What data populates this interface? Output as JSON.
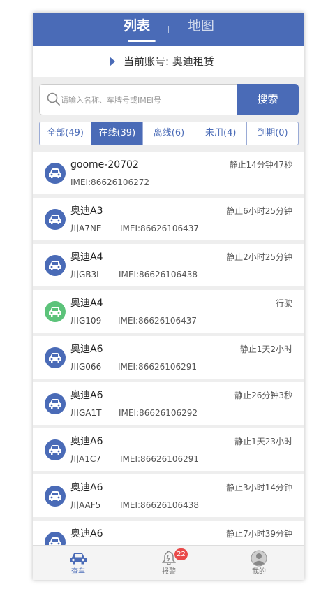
{
  "header": {
    "tabs": [
      {
        "label": "列表",
        "active": true
      },
      {
        "label": "地图",
        "active": false
      }
    ]
  },
  "account": {
    "text": "当前账号: 奥迪租赁"
  },
  "search": {
    "placeholder": "请输入名称、车牌号或IMEI号",
    "button_label": "搜索"
  },
  "filters": [
    {
      "label": "全部(49)",
      "active": false
    },
    {
      "label": "在线(39)",
      "active": true
    },
    {
      "label": "离线(6)",
      "active": false
    },
    {
      "label": "未用(4)",
      "active": false
    },
    {
      "label": "到期(0)",
      "active": false
    }
  ],
  "vehicles": [
    {
      "name": "goome-20702",
      "status": "静止14分钟47秒",
      "plate": "",
      "imei": "IMEI:86626106272",
      "icon": "car-icon",
      "color": "#4a6bb7"
    },
    {
      "name": "奥迪A3",
      "status": "静止6小时25分钟",
      "plate": "川A7NE",
      "imei": "IMEI:86626106437",
      "icon": "car-icon",
      "color": "#4a6bb7"
    },
    {
      "name": "奥迪A4",
      "status": "静止2小时25分钟",
      "plate": "川GB3L",
      "imei": "IMEI:86626106438",
      "icon": "car-icon",
      "color": "#4a6bb7"
    },
    {
      "name": "奥迪A4",
      "status": "行驶",
      "plate": "川G109",
      "imei": "IMEI:86626106437",
      "icon": "car-icon",
      "color": "#5cc37a"
    },
    {
      "name": "奥迪A6",
      "status": "静止1天2小时",
      "plate": "川G066",
      "imei": "IMEI:86626106291",
      "icon": "car-icon",
      "color": "#4a6bb7"
    },
    {
      "name": "奥迪A6",
      "status": "静止26分钟3秒",
      "plate": "川GA1T",
      "imei": "IMEI:86626106292",
      "icon": "car-icon",
      "color": "#4a6bb7"
    },
    {
      "name": "奥迪A6",
      "status": "静止1天23小时",
      "plate": "川A1C7",
      "imei": "IMEI:86626106291",
      "icon": "car-icon",
      "color": "#4a6bb7"
    },
    {
      "name": "奥迪A6",
      "status": "静止3小时14分钟",
      "plate": "川AAF5",
      "imei": "IMEI:86626106438",
      "icon": "car-icon",
      "color": "#4a6bb7"
    },
    {
      "name": "奥迪A6",
      "status": "静止7小时39分钟",
      "plate": "",
      "imei": "",
      "icon": "car-icon",
      "color": "#4a6bb7"
    }
  ],
  "bottom_nav": [
    {
      "label": "查车",
      "icon": "car-icon",
      "active": true
    },
    {
      "label": "报警",
      "icon": "bell-icon",
      "badge": "22",
      "active": false
    },
    {
      "label": "我的",
      "icon": "user-icon",
      "active": false
    }
  ],
  "colors": {
    "accent": "#4a6bb7",
    "moving": "#5cc37a",
    "badge": "#e94a4a"
  }
}
